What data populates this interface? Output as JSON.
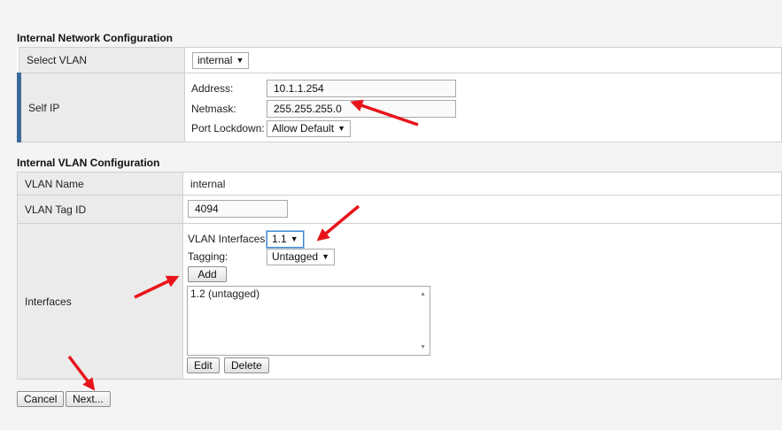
{
  "network": {
    "title": "Internal Network Configuration",
    "select_vlan_label": "Select VLAN",
    "select_vlan_value": "internal",
    "self_ip_label": "Self IP",
    "address_label": "Address:",
    "address_value": "10.1.1.254",
    "netmask_label": "Netmask:",
    "netmask_value": "255.255.255.0",
    "port_lockdown_label": "Port Lockdown:",
    "port_lockdown_value": "Allow Default"
  },
  "vlan": {
    "title": "Internal VLAN Configuration",
    "name_label": "VLAN Name",
    "name_value": "internal",
    "tag_label": "VLAN Tag ID",
    "tag_value": "4094",
    "interfaces_label": "Interfaces",
    "vlan_interfaces_label": "VLAN Interfaces",
    "vlan_interfaces_value": "1.1",
    "tagging_label": "Tagging:",
    "tagging_value": "Untagged",
    "add_label": "Add",
    "interface_list": [
      "1.2 (untagged)"
    ],
    "edit_label": "Edit",
    "delete_label": "Delete"
  },
  "footer": {
    "cancel_label": "Cancel",
    "next_label": "Next..."
  },
  "colors": {
    "accent_bar": "#3b6a99",
    "annotation_arrow": "#e8141b"
  }
}
